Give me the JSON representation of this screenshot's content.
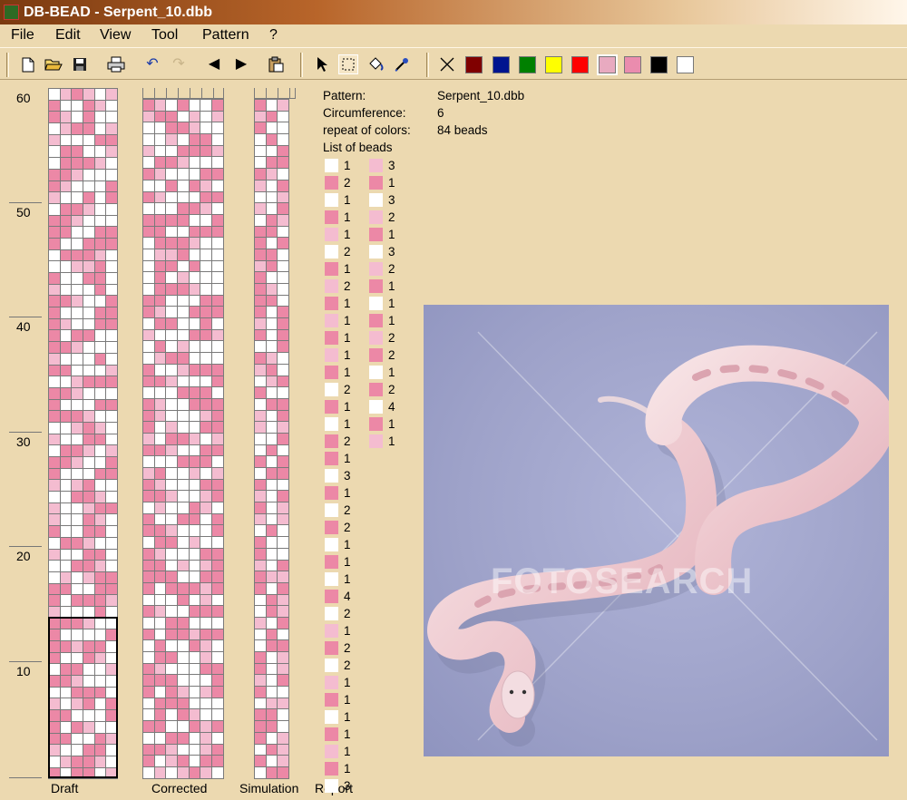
{
  "window": {
    "title": "DB-BEAD - Serpent_10.dbb"
  },
  "menu": [
    "File",
    "Edit",
    "View",
    "Tool",
    "Pattern",
    "?"
  ],
  "toolbar": {
    "icons": [
      "new-file-icon",
      "open-folder-icon",
      "save-icon",
      "print-icon",
      "undo-icon",
      "redo-icon",
      "arrow-left-icon",
      "arrow-right-icon",
      "paste-icon",
      "pointer-icon",
      "select-rect-icon",
      "fill-icon",
      "eyedropper-icon",
      "no-color-icon"
    ],
    "swatches": [
      "#800000",
      "#00148f",
      "#008000",
      "#ffff00",
      "#ff0000",
      "#e8aac0",
      "#ea8cae",
      "#000000",
      "#ffffff"
    ]
  },
  "ruler": {
    "labels": [
      "60",
      "50",
      "40",
      "30",
      "20",
      "10"
    ]
  },
  "colors": {
    "white": "#ffffff",
    "light": "#f4bcd0",
    "dark": "#ec88a6"
  },
  "pattern": {
    "circumference": 6,
    "rows": 60,
    "draft_rows": [
      "WLDLWL",
      "DWWDLW",
      "DLWDWW",
      "WLDDWL",
      "LWWWDD",
      "WDDWWL",
      "WDDDLW",
      "DDLWWW",
      "DLWWWD",
      "LWWDWD",
      "WDDLWW",
      "DDLWWW",
      "DDWWDD",
      "DWWDDD",
      "WDDDLW",
      "WWLLDW",
      "DWWDDW",
      "LWWWDW",
      "DDLWWD",
      "DWWWDD",
      "DLWWDD",
      "DWDDWW",
      "DDLWWW",
      "LWWWDW",
      "DDWWWL",
      "WWLDDD",
      "DDLWWW",
      "DWWWDD",
      "DDDLWW",
      "WWLDLW",
      "LWWDDW",
      "WDDLWL",
      "DDLWWD",
      "DWWWDD",
      "LWLDWW",
      "WWDDLW",
      "LWWLDD",
      "LWWDLW",
      "DWWDDW",
      "WDDLWW",
      "LWWDDW",
      "WWDDLW",
      "WLWLDD",
      "DDWWDD",
      "DWDDDL",
      "LWWWDW",
      "DDDLWW",
      "DWWWWD",
      "DDLDDW",
      "DWWDLW",
      "WDDWWL",
      "DDLWWW",
      "WWDDDW",
      "LWLDWD",
      "DDWWWD",
      "DWDLWW",
      "DDWWDL",
      "LWWDDW",
      "WLDDLW",
      "DWDDWL"
    ]
  },
  "captions": {
    "draft": "Draft",
    "corrected": "Corrected",
    "simulation": "Simulation",
    "report": "Report"
  },
  "report": {
    "pattern_label": "Pattern:",
    "pattern_value": "Serpent_10.dbb",
    "circumference_label": "Circumference:",
    "circumference_value": "6",
    "repeat_label": "repeat of colors:",
    "repeat_value": "84 beads",
    "list_label": "List of beads",
    "beads_col1": [
      [
        "W",
        "1"
      ],
      [
        "D",
        "2"
      ],
      [
        "W",
        "1"
      ],
      [
        "D",
        "1"
      ],
      [
        "L",
        "1"
      ],
      [
        "W",
        "2"
      ],
      [
        "D",
        "1"
      ],
      [
        "L",
        "2"
      ],
      [
        "D",
        "1"
      ],
      [
        "L",
        "1"
      ],
      [
        "D",
        "1"
      ],
      [
        "L",
        "1"
      ],
      [
        "D",
        "1"
      ],
      [
        "W",
        "2"
      ],
      [
        "D",
        "1"
      ],
      [
        "W",
        "1"
      ],
      [
        "D",
        "2"
      ],
      [
        "D",
        "1"
      ],
      [
        "W",
        "3"
      ],
      [
        "D",
        "1"
      ],
      [
        "W",
        "2"
      ],
      [
        "D",
        "2"
      ],
      [
        "W",
        "1"
      ],
      [
        "D",
        "1"
      ],
      [
        "W",
        "1"
      ],
      [
        "D",
        "4"
      ],
      [
        "W",
        "2"
      ],
      [
        "L",
        "1"
      ],
      [
        "D",
        "2"
      ],
      [
        "W",
        "2"
      ],
      [
        "L",
        "1"
      ],
      [
        "D",
        "1"
      ],
      [
        "W",
        "1"
      ],
      [
        "D",
        "1"
      ],
      [
        "L",
        "1"
      ],
      [
        "D",
        "1"
      ],
      [
        "W",
        "3"
      ]
    ],
    "beads_col2": [
      [
        "L",
        "3"
      ],
      [
        "D",
        "1"
      ],
      [
        "W",
        "3"
      ],
      [
        "L",
        "2"
      ],
      [
        "D",
        "1"
      ],
      [
        "W",
        "3"
      ],
      [
        "L",
        "2"
      ],
      [
        "D",
        "1"
      ],
      [
        "W",
        "1"
      ],
      [
        "D",
        "1"
      ],
      [
        "L",
        "2"
      ],
      [
        "D",
        "2"
      ],
      [
        "W",
        "1"
      ],
      [
        "D",
        "2"
      ],
      [
        "W",
        "4"
      ],
      [
        "D",
        "1"
      ],
      [
        "L",
        "1"
      ]
    ]
  },
  "image": {
    "watermark": "FOTOSEARCH"
  }
}
